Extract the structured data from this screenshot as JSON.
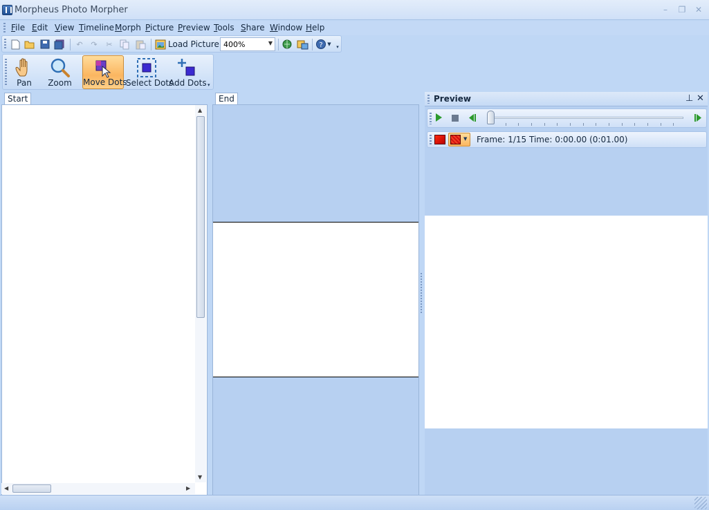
{
  "window": {
    "title": "Morpheus Photo Morpher"
  },
  "menu": [
    "File",
    "Edit",
    "View",
    "Timeline",
    "Morph",
    "Picture",
    "Preview",
    "Tools",
    "Share",
    "Window",
    "Help"
  ],
  "toolbar": {
    "icons": [
      "new-icon",
      "open-icon",
      "save-icon",
      "save-all-icon",
      "undo-icon",
      "redo-icon",
      "cut-icon",
      "copy-icon",
      "paste-icon",
      "load-picture-icon",
      "web-icon",
      "export-icon",
      "help-icon"
    ],
    "load_picture_label": "Load Picture...",
    "zoom_value": "400%"
  },
  "tools": {
    "pan": "Pan",
    "zoom": "Zoom",
    "move_dots": "Move Dots",
    "select_dots": "Select Dots",
    "add_dots": "Add Dots",
    "active": "Move Dots"
  },
  "panels": {
    "start_tab": "Start",
    "end_tab": "End"
  },
  "preview": {
    "title": "Preview",
    "frame_info": "Frame: 1/15 Time: 0:00.00 (0:01.00)",
    "position": 0
  },
  "colors": {
    "accent": "#fbb661",
    "background": "#bfd7f5",
    "canvas_area": "#b7d0f1"
  }
}
